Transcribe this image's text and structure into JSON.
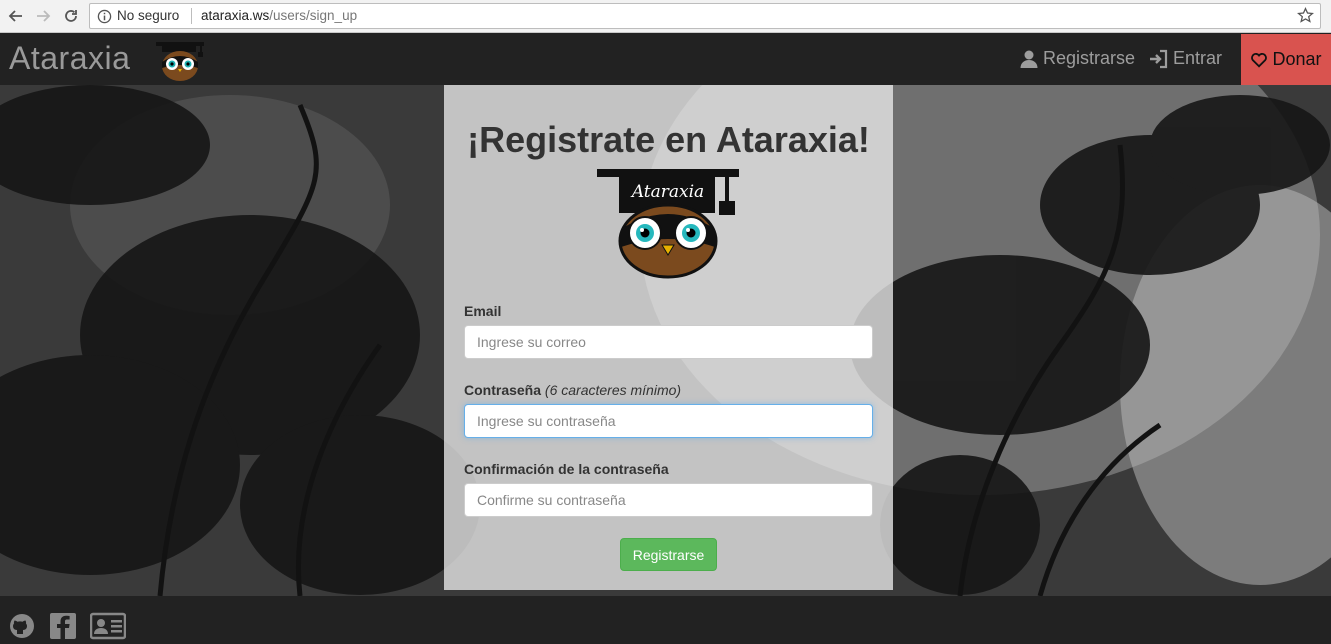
{
  "browser": {
    "security_text": "No seguro",
    "url_host": "ataraxia.ws",
    "url_path": "/users/sign_up"
  },
  "navbar": {
    "brand": "Ataraxia",
    "register_label": "Registrarse",
    "login_label": "Entrar",
    "donate_label": "Donar",
    "donate_color": "#d9534f"
  },
  "signup": {
    "title": "¡Registrate en Ataraxia!",
    "logo_text": "Ataraxia",
    "email_label": "Email",
    "email_placeholder": "Ingrese su correo",
    "password_label": "Contraseña",
    "password_hint": "(6 caracteres mínimo)",
    "password_placeholder": "Ingrese su contraseña",
    "confirm_label": "Confirmación de la contraseña",
    "confirm_placeholder": "Confirme su contraseña",
    "submit_label": "Registrarse",
    "submit_color": "#5cb85c"
  },
  "footer": {
    "icons": [
      "github-icon",
      "facebook-icon",
      "contact-card-icon"
    ]
  }
}
